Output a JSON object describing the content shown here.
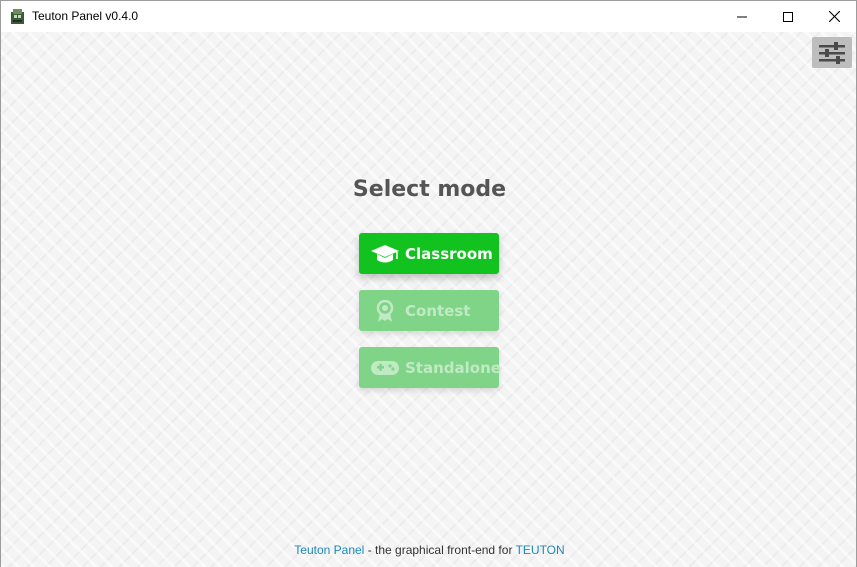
{
  "window": {
    "title": "Teuton Panel v0.4.0"
  },
  "main": {
    "heading": "Select mode",
    "modes": [
      {
        "label": "Classroom",
        "icon": "graduation-cap-icon",
        "enabled": true
      },
      {
        "label": "Contest",
        "icon": "award-ribbon-icon",
        "enabled": false
      },
      {
        "label": "Standalone",
        "icon": "gamepad-icon",
        "enabled": false
      }
    ]
  },
  "footer": {
    "app_link": "Teuton Panel",
    "middle_text": " - the graphical front-end for ",
    "project_link": "TEUTON"
  },
  "colors": {
    "primary_green": "#12c21f",
    "disabled_green": "#7fd487",
    "link_blue": "#1a8ab8",
    "heading_gray": "#555555"
  }
}
